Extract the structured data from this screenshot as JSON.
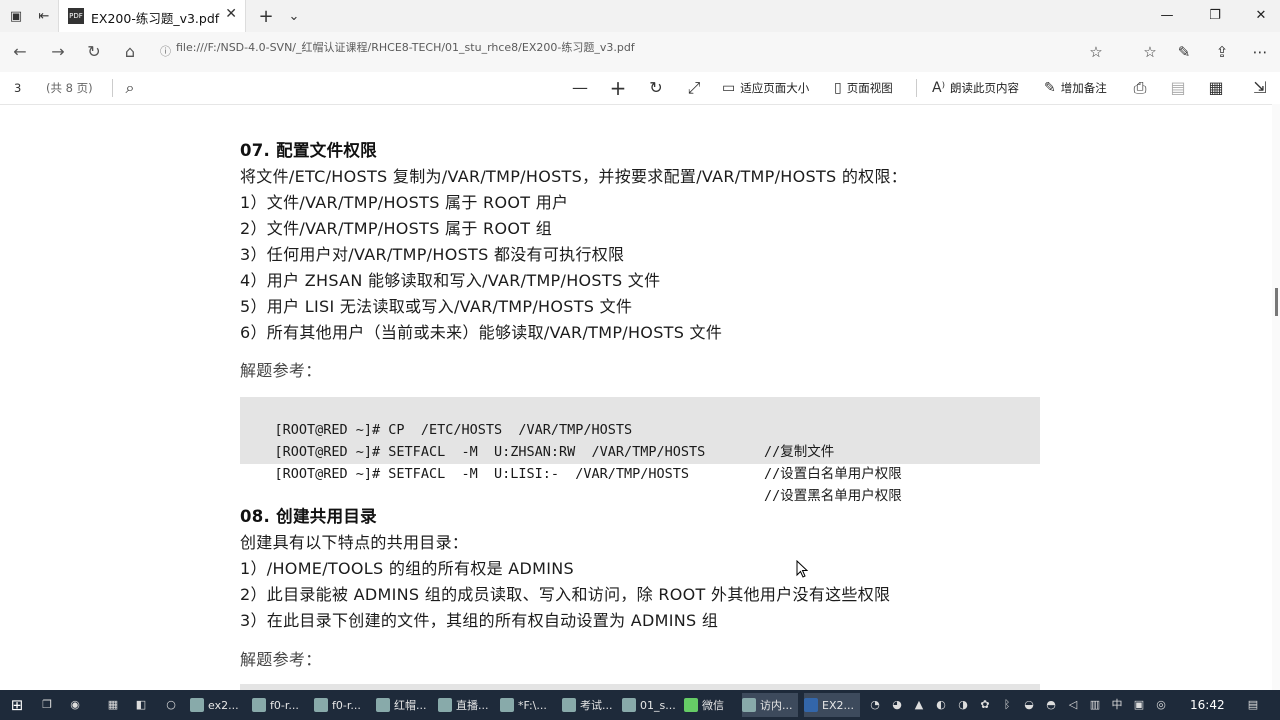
{
  "browser": {
    "tab_title": "EX200-练习题_v3.pdf",
    "pdf_badge": "PDF",
    "new_tab": "+",
    "tab_menu": "⌄",
    "close_tab": "✕",
    "url": "file:///F:/NSD-4.0-SVN/_红帽认证课程/RHCE8-TECH/01_stu_rhce8/EX200-练习题_v3.pdf",
    "window_controls": [
      "—",
      "❐",
      "✕"
    ]
  },
  "pdf_toolbar": {
    "page_current": "3",
    "page_total": "(共 8 页)",
    "fit_page": "适应页面大小",
    "page_view": "页面视图",
    "read_aloud": "朗读此页内容",
    "add_note": "增加备注"
  },
  "document": {
    "s07_title": "07.  配置文件权限",
    "s07_intro": "将文件/ETC/HOSTS 复制为/VAR/TMP/HOSTS，并按要求配置/VAR/TMP/HOSTS 的权限：",
    "s07_items": [
      "1）文件/VAR/TMP/HOSTS 属于 ROOT 用户",
      "2）文件/VAR/TMP/HOSTS 属于 ROOT 组",
      "3）任何用户对/VAR/TMP/HOSTS 都没有可执行权限",
      "4）用户 ZHSAN 能够读取和写入/VAR/TMP/HOSTS 文件",
      "5）用户 LISI 无法读取或写入/VAR/TMP/HOSTS 文件",
      "6）所有其他用户（当前或未来）能够读取/VAR/TMP/HOSTS 文件"
    ],
    "s07_ref": "解题参考：",
    "s07_code": [
      {
        "cmd": "[ROOT@RED ~]# CP  /ETC/HOSTS  /VAR/TMP/HOSTS",
        "comment": "//复制文件"
      },
      {
        "cmd": "[ROOT@RED ~]# SETFACL  -M  U:ZHSAN:RW  /VAR/TMP/HOSTS",
        "comment": "//设置白名单用户权限"
      },
      {
        "cmd": "[ROOT@RED ~]# SETFACL  -M  U:LISI:-  /VAR/TMP/HOSTS",
        "comment": "//设置黑名单用户权限"
      }
    ],
    "s08_title": "08.  创建共用目录",
    "s08_intro": "创建具有以下特点的共用目录：",
    "s08_items": [
      "1）/HOME/TOOLS 的组的所有权是 ADMINS",
      "2）此目录能被 ADMINS 组的成员读取、写入和访问，除 ROOT 外其他用户没有这些权限",
      "3）在此目录下创建的文件，其组的所有权自动设置为 ADMINS 组"
    ],
    "s08_ref": "解题参考："
  },
  "taskbar": {
    "items": [
      "ex2...",
      "f0-r...",
      "f0-r...",
      "红帽...",
      "直播...",
      "*F:\\...",
      "考试...",
      "01_s...",
      "微信",
      "访内...",
      "EX2..."
    ],
    "clock": "16:42"
  },
  "colors": {
    "code_bg": "#e4e4e4",
    "taskbar_bg": "#1e2a3a"
  }
}
